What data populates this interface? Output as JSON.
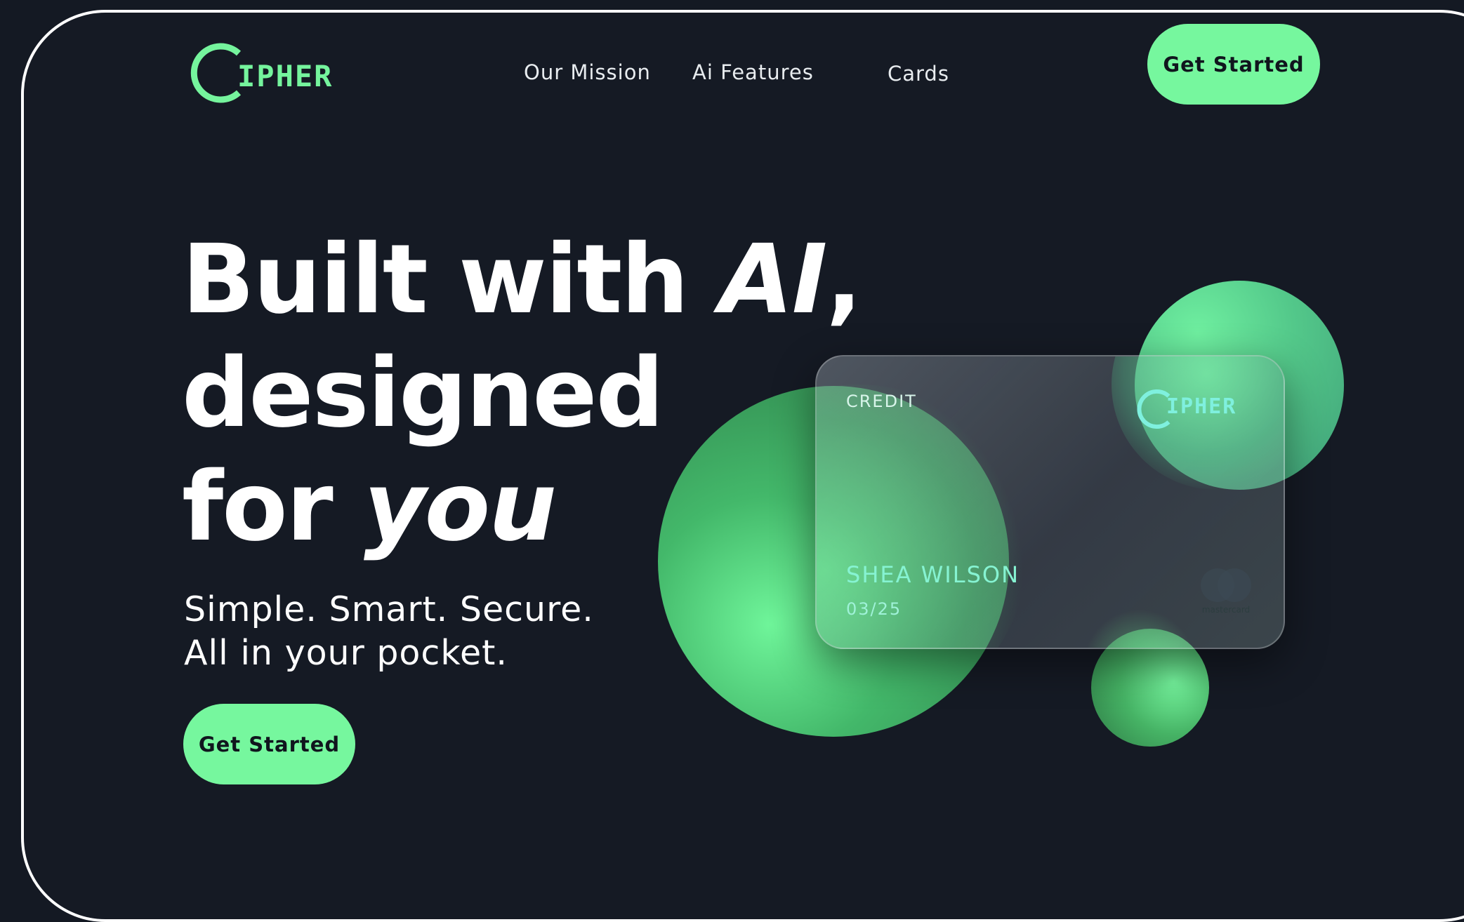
{
  "brand": {
    "logo_text": "IPHER",
    "accent_color": "#76f79e"
  },
  "nav": {
    "links": [
      {
        "label": "Our Mission"
      },
      {
        "label": "Ai Features"
      },
      {
        "label": "Cards"
      }
    ],
    "cta_label": "Get Started"
  },
  "hero": {
    "headline_line1_pre": "Built with ",
    "headline_line1_em": "AI",
    "headline_line1_post": ",",
    "headline_line2": "designed",
    "headline_line3_pre": "for ",
    "headline_line3_em": "you",
    "subline1": "Simple. Smart. Secure.",
    "subline2": "All in your pocket.",
    "cta_label": "Get Started"
  },
  "card": {
    "type_label": "CREDIT",
    "logo_text": "IPHER",
    "holder_name": "SHEA WILSON",
    "expiry": "03/25",
    "network_label": "mastercard"
  }
}
